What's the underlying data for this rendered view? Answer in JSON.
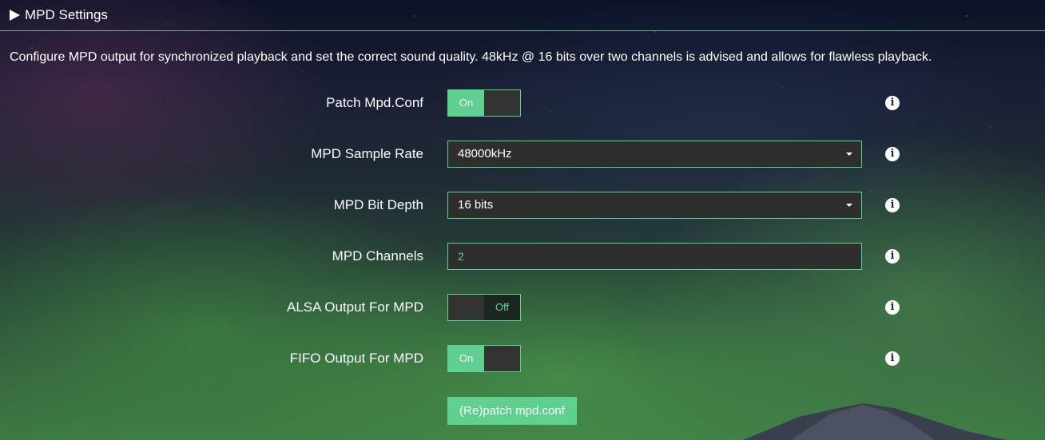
{
  "section": {
    "title": "MPD Settings",
    "description": "Configure MPD output for synchronized playback and set the correct sound quality. 48kHz @ 16 bits over two channels is advised and allows for flawless playback."
  },
  "settings": {
    "patch_mpd_conf": {
      "label": "Patch Mpd.Conf",
      "on_label": "On",
      "off_label": "",
      "state": "on"
    },
    "sample_rate": {
      "label": "MPD Sample Rate",
      "value": "48000kHz"
    },
    "bit_depth": {
      "label": "MPD Bit Depth",
      "value": "16 bits"
    },
    "channels": {
      "label": "MPD Channels",
      "value": "2"
    },
    "alsa_output": {
      "label": "ALSA Output For MPD",
      "on_label": "",
      "off_label": "Off",
      "state": "off"
    },
    "fifo_output": {
      "label": "FIFO Output For MPD",
      "on_label": "On",
      "off_label": "",
      "state": "on"
    }
  },
  "icons": {
    "header": "triangle-right-icon",
    "info": "info-icon",
    "dropdown": "caret-down-icon"
  },
  "info_glyph": "i",
  "actions": {
    "patch_button": "(Re)patch mpd.conf"
  },
  "colors": {
    "accent": "#5fd090",
    "field_bg": "#2e2e2e"
  }
}
